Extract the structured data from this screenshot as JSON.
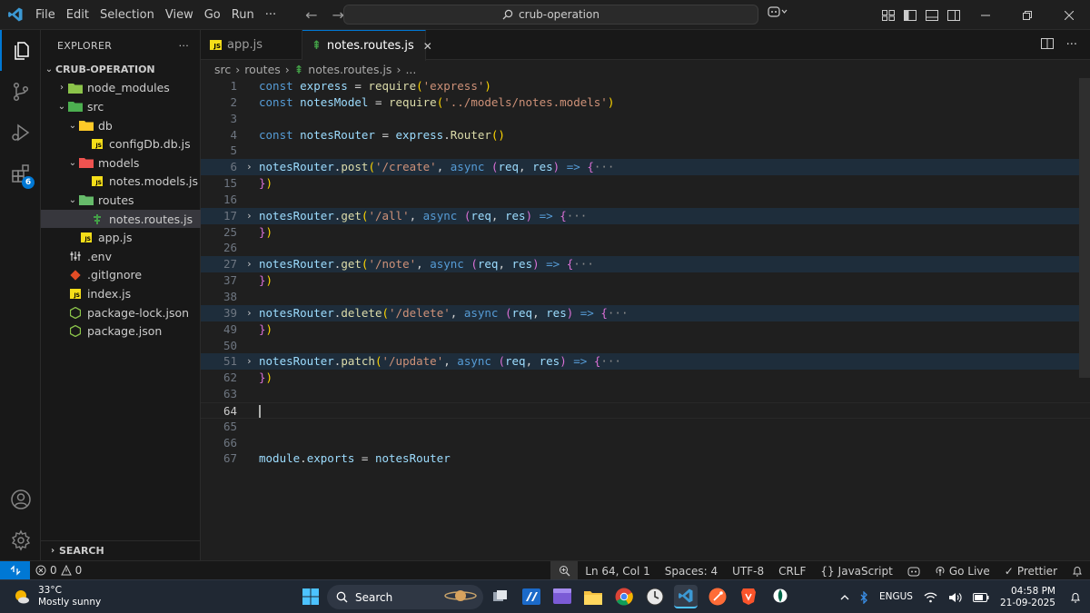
{
  "titlebar": {
    "menu": [
      "File",
      "Edit",
      "Selection",
      "View",
      "Go",
      "Run",
      "···"
    ],
    "search_text": "crub-operation"
  },
  "activitybar": {
    "extensions_badge": "6"
  },
  "sidebar": {
    "title": "EXPLORER",
    "more": "···",
    "project": "CRUB-OPERATION",
    "tree": [
      {
        "label": "node_modules",
        "depth": 1,
        "chevron": "›",
        "icon": "folder-node-icon",
        "color": "#8bc34a"
      },
      {
        "label": "src",
        "depth": 1,
        "chevron": "⌄",
        "icon": "folder-src-icon",
        "color": "#4caf50"
      },
      {
        "label": "db",
        "depth": 2,
        "chevron": "⌄",
        "icon": "folder-db-icon",
        "color": "#ffca28"
      },
      {
        "label": "configDb.db.js",
        "depth": 3,
        "chevron": "",
        "icon": "js-file-icon",
        "color": "#f5de19"
      },
      {
        "label": "models",
        "depth": 2,
        "chevron": "⌄",
        "icon": "folder-models-icon",
        "color": "#ef5350"
      },
      {
        "label": "notes.models.js",
        "depth": 3,
        "chevron": "",
        "icon": "js-file-icon",
        "color": "#f5de19"
      },
      {
        "label": "routes",
        "depth": 2,
        "chevron": "⌄",
        "icon": "folder-routes-icon",
        "color": "#66bb6a"
      },
      {
        "label": "notes.routes.js",
        "depth": 3,
        "chevron": "",
        "icon": "routes-file-icon",
        "color": "#43a047",
        "selected": true
      },
      {
        "label": "app.js",
        "depth": 2,
        "chevron": "",
        "icon": "js-file-icon",
        "color": "#f5de19"
      },
      {
        "label": ".env",
        "depth": 1,
        "chevron": "",
        "icon": "env-file-icon",
        "color": "#cccccc"
      },
      {
        "label": ".gitIgnore",
        "depth": 1,
        "chevron": "",
        "icon": "git-file-icon",
        "color": "#e44d26"
      },
      {
        "label": "index.js",
        "depth": 1,
        "chevron": "",
        "icon": "js-file-icon",
        "color": "#f5de19"
      },
      {
        "label": "package-lock.json",
        "depth": 1,
        "chevron": "",
        "icon": "npm-file-icon",
        "color": "#8bc34a"
      },
      {
        "label": "package.json",
        "depth": 1,
        "chevron": "",
        "icon": "npm-file-icon",
        "color": "#8bc34a"
      }
    ],
    "search_section": "SEARCH"
  },
  "editor": {
    "tabs": [
      {
        "label": "app.js",
        "active": false
      },
      {
        "label": "notes.routes.js",
        "active": true
      }
    ],
    "close_glyph": "✕",
    "breadcrumb": [
      "src",
      "routes",
      "notes.routes.js",
      "..."
    ],
    "lines": [
      {
        "n": "1",
        "folded": false,
        "tokens": [
          [
            "k",
            "const "
          ],
          [
            "v",
            "express"
          ],
          [
            "p",
            " = "
          ],
          [
            "f",
            "require"
          ],
          [
            "br1",
            "("
          ],
          [
            "s",
            "'express'"
          ],
          [
            "br1",
            ")"
          ]
        ]
      },
      {
        "n": "2",
        "folded": false,
        "tokens": [
          [
            "k",
            "const "
          ],
          [
            "v",
            "notesModel"
          ],
          [
            "p",
            " = "
          ],
          [
            "f",
            "require"
          ],
          [
            "br1",
            "("
          ],
          [
            "s",
            "'../models/notes.models'"
          ],
          [
            "br1",
            ")"
          ]
        ]
      },
      {
        "n": "3",
        "folded": false,
        "tokens": []
      },
      {
        "n": "4",
        "folded": false,
        "tokens": [
          [
            "k",
            "const "
          ],
          [
            "v",
            "notesRouter"
          ],
          [
            "p",
            " = "
          ],
          [
            "v",
            "express"
          ],
          [
            "p",
            "."
          ],
          [
            "f",
            "Router"
          ],
          [
            "br1",
            "()"
          ]
        ]
      },
      {
        "n": "5",
        "folded": false,
        "tokens": []
      },
      {
        "n": "6",
        "folded": true,
        "tokens": [
          [
            "v",
            "notesRouter"
          ],
          [
            "p",
            "."
          ],
          [
            "f",
            "post"
          ],
          [
            "br1",
            "("
          ],
          [
            "s",
            "'/create'"
          ],
          [
            "p",
            ", "
          ],
          [
            "k",
            "async "
          ],
          [
            "br2",
            "("
          ],
          [
            "v",
            "req"
          ],
          [
            "p",
            ", "
          ],
          [
            "v",
            "res"
          ],
          [
            "br2",
            ")"
          ],
          [
            "k",
            " => "
          ],
          [
            "br2",
            "{"
          ],
          [
            "ell",
            "···"
          ]
        ]
      },
      {
        "n": "15",
        "folded": false,
        "tokens": [
          [
            "br2",
            "}"
          ],
          [
            "br1",
            ")"
          ]
        ]
      },
      {
        "n": "16",
        "folded": false,
        "tokens": []
      },
      {
        "n": "17",
        "folded": true,
        "tokens": [
          [
            "v",
            "notesRouter"
          ],
          [
            "p",
            "."
          ],
          [
            "f",
            "get"
          ],
          [
            "br1",
            "("
          ],
          [
            "s",
            "'/all'"
          ],
          [
            "p",
            ", "
          ],
          [
            "k",
            "async "
          ],
          [
            "br2",
            "("
          ],
          [
            "v",
            "req"
          ],
          [
            "p",
            ", "
          ],
          [
            "v",
            "res"
          ],
          [
            "br2",
            ")"
          ],
          [
            "k",
            " => "
          ],
          [
            "br2",
            "{"
          ],
          [
            "ell",
            "···"
          ]
        ]
      },
      {
        "n": "25",
        "folded": false,
        "tokens": [
          [
            "br2",
            "}"
          ],
          [
            "br1",
            ")"
          ]
        ]
      },
      {
        "n": "26",
        "folded": false,
        "tokens": []
      },
      {
        "n": "27",
        "folded": true,
        "tokens": [
          [
            "v",
            "notesRouter"
          ],
          [
            "p",
            "."
          ],
          [
            "f",
            "get"
          ],
          [
            "br1",
            "("
          ],
          [
            "s",
            "'/note'"
          ],
          [
            "p",
            ", "
          ],
          [
            "k",
            "async "
          ],
          [
            "br2",
            "("
          ],
          [
            "v",
            "req"
          ],
          [
            "p",
            ", "
          ],
          [
            "v",
            "res"
          ],
          [
            "br2",
            ")"
          ],
          [
            "k",
            " => "
          ],
          [
            "br2",
            "{"
          ],
          [
            "ell",
            "···"
          ]
        ]
      },
      {
        "n": "37",
        "folded": false,
        "tokens": [
          [
            "br2",
            "}"
          ],
          [
            "br1",
            ")"
          ]
        ]
      },
      {
        "n": "38",
        "folded": false,
        "tokens": []
      },
      {
        "n": "39",
        "folded": true,
        "tokens": [
          [
            "v",
            "notesRouter"
          ],
          [
            "p",
            "."
          ],
          [
            "f",
            "delete"
          ],
          [
            "br1",
            "("
          ],
          [
            "s",
            "'/delete'"
          ],
          [
            "p",
            ", "
          ],
          [
            "k",
            "async "
          ],
          [
            "br2",
            "("
          ],
          [
            "v",
            "req"
          ],
          [
            "p",
            ", "
          ],
          [
            "v",
            "res"
          ],
          [
            "br2",
            ")"
          ],
          [
            "k",
            " => "
          ],
          [
            "br2",
            "{"
          ],
          [
            "ell",
            "···"
          ]
        ]
      },
      {
        "n": "49",
        "folded": false,
        "tokens": [
          [
            "br2",
            "}"
          ],
          [
            "br1",
            ")"
          ]
        ]
      },
      {
        "n": "50",
        "folded": false,
        "tokens": []
      },
      {
        "n": "51",
        "folded": true,
        "tokens": [
          [
            "v",
            "notesRouter"
          ],
          [
            "p",
            "."
          ],
          [
            "f",
            "patch"
          ],
          [
            "br1",
            "("
          ],
          [
            "s",
            "'/update'"
          ],
          [
            "p",
            ", "
          ],
          [
            "k",
            "async "
          ],
          [
            "br2",
            "("
          ],
          [
            "v",
            "req"
          ],
          [
            "p",
            ", "
          ],
          [
            "v",
            "res"
          ],
          [
            "br2",
            ")"
          ],
          [
            "k",
            " => "
          ],
          [
            "br2",
            "{"
          ],
          [
            "ell",
            "···"
          ]
        ]
      },
      {
        "n": "62",
        "folded": false,
        "tokens": [
          [
            "br2",
            "}"
          ],
          [
            "br1",
            ")"
          ]
        ]
      },
      {
        "n": "63",
        "folded": false,
        "tokens": []
      },
      {
        "n": "64",
        "folded": false,
        "current": true,
        "tokens": []
      },
      {
        "n": "65",
        "folded": false,
        "tokens": []
      },
      {
        "n": "66",
        "folded": false,
        "tokens": []
      },
      {
        "n": "67",
        "folded": false,
        "tokens": [
          [
            "v",
            "module"
          ],
          [
            "p",
            "."
          ],
          [
            "v",
            "exports"
          ],
          [
            "p",
            " = "
          ],
          [
            "v",
            "notesRouter"
          ]
        ]
      }
    ]
  },
  "statusbar": {
    "errors": "0",
    "warnings": "0",
    "position": "Ln 64, Col 1",
    "spaces": "Spaces: 4",
    "encoding": "UTF-8",
    "eol": "CRLF",
    "language_glyph": "{}",
    "language": "JavaScript",
    "golive": "Go Live",
    "prettier": "Prettier"
  },
  "taskbar": {
    "temperature": "33°C",
    "weather": "Mostly sunny",
    "search_label": "Search",
    "lang_line1": "ENG",
    "lang_line2": "US",
    "time": "04:58 PM",
    "date": "21-09-2025"
  },
  "colors": {
    "accent": "#0078d4",
    "background": "#1f1f1f",
    "sidebar": "#181818"
  }
}
